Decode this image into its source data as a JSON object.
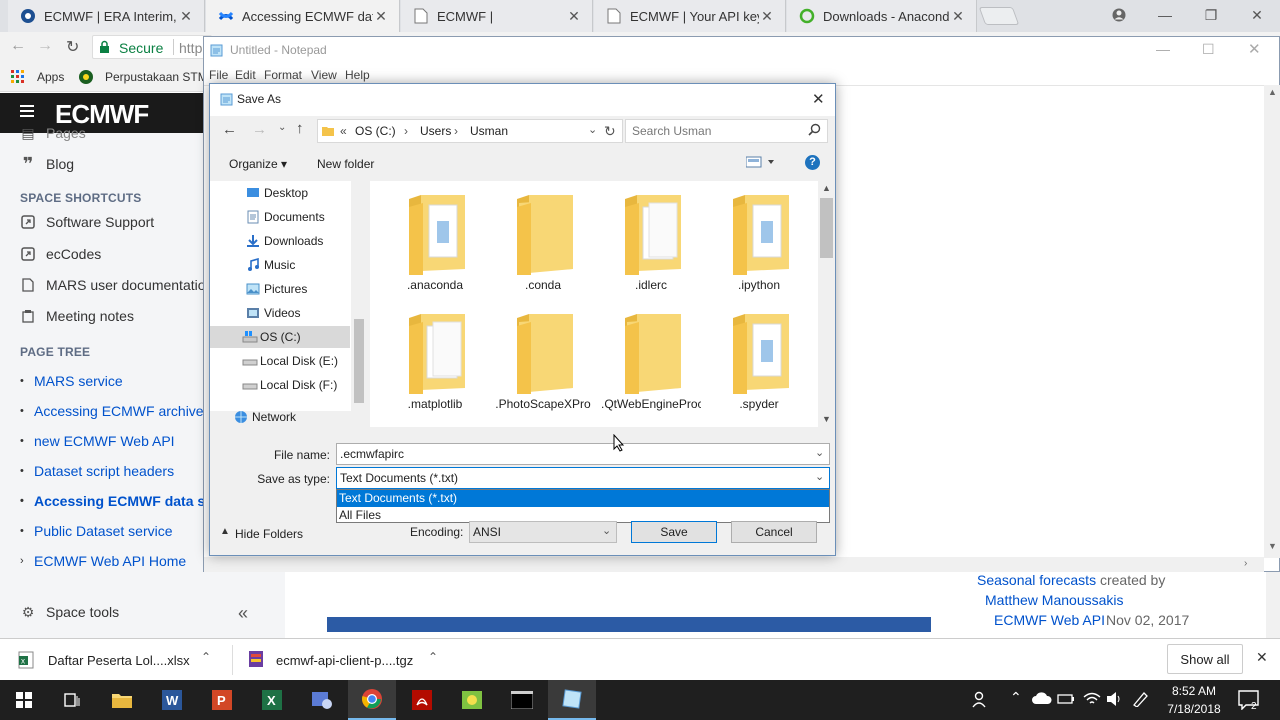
{
  "browser": {
    "tabs": [
      {
        "title": "ECMWF | ERA Interim, Da"
      },
      {
        "title": "Accessing ECMWF data s"
      },
      {
        "title": "ECMWF |"
      },
      {
        "title": "ECMWF | Your API key"
      },
      {
        "title": "Downloads - Anaconda"
      }
    ],
    "secure_label": "Secure",
    "url_partial": "http",
    "bookmarks": {
      "apps": "Apps",
      "item1": "Perpustakaan STM"
    }
  },
  "confluence": {
    "logo_text": "ECMWF",
    "pages_partial": "Pages",
    "blog": "Blog",
    "space_shortcuts_heading": "SPACE SHORTCUTS",
    "shortcuts": [
      "Software Support",
      "ecCodes",
      "MARS user documentatio",
      "Meeting notes"
    ],
    "page_tree_heading": "PAGE TREE",
    "tree": [
      {
        "label": "MARS service",
        "marker": "•",
        "bold": false
      },
      {
        "label": "Accessing ECMWF archive u",
        "marker": "•",
        "bold": false
      },
      {
        "label": "new ECMWF Web API",
        "marker": "•",
        "bold": false
      },
      {
        "label": "Dataset script headers",
        "marker": "•",
        "bold": false
      },
      {
        "label": "Accessing ECMWF data se",
        "marker": "•",
        "bold": true
      },
      {
        "label": "Public Dataset service",
        "marker": "•",
        "bold": false
      },
      {
        "label": "ECMWF Web API Home",
        "marker": "›",
        "bold": false
      }
    ],
    "space_tools": "Space tools",
    "collapse": "«",
    "recent": {
      "link1": "Seasonal forecasts",
      "created_by": "created by",
      "author": "Matthew Manoussakis",
      "space": "ECMWF Web API",
      "date": "Nov 02, 2017"
    }
  },
  "notepad": {
    "title": "Untitled - Notepad",
    "menu": [
      "File",
      "Edit",
      "Format",
      "View",
      "Help"
    ]
  },
  "dialog": {
    "title": "Save As",
    "path": [
      "«",
      "OS (C:)",
      "›",
      "Users",
      "›",
      "Usman"
    ],
    "search_placeholder": "Search Usman",
    "organize": "Organize ▾",
    "new_folder": "New folder",
    "nav": [
      {
        "label": "Desktop",
        "sel": false
      },
      {
        "label": "Documents",
        "sel": false
      },
      {
        "label": "Downloads",
        "sel": false
      },
      {
        "label": "Music",
        "sel": false
      },
      {
        "label": "Pictures",
        "sel": false
      },
      {
        "label": "Videos",
        "sel": false
      },
      {
        "label": "OS (C:)",
        "sel": true
      },
      {
        "label": "Local Disk (E:)",
        "sel": false
      },
      {
        "label": "Local Disk (F:)",
        "sel": false
      },
      {
        "label": "Network",
        "sel": false
      }
    ],
    "folders": [
      ".anaconda",
      ".conda",
      ".idlerc",
      ".ipython",
      ".matplotlib",
      ".PhotoScapeXPro",
      ".QtWebEngineProcess",
      ".spyder"
    ],
    "file_name_label": "File name:",
    "file_name_value": ".ecmwfapirc",
    "save_type_label": "Save as type:",
    "save_type_value": "Text Documents (*.txt)",
    "type_options": [
      "Text Documents (*.txt)",
      "All Files"
    ],
    "hide_folders": "Hide Folders",
    "encoding_label": "Encoding:",
    "encoding_value": "ANSI",
    "save": "Save",
    "cancel": "Cancel"
  },
  "downloads": {
    "item1": "Daftar Peserta Lol....xlsx",
    "item2": "ecmwf-api-client-p....tgz",
    "show_all": "Show all"
  },
  "taskbar": {
    "time": "8:52 AM",
    "date": "7/18/2018",
    "notif_count": "2"
  },
  "colors": {
    "accent_blue": "#0078d7",
    "link_blue": "#0052cc",
    "folder_yellow": "#f8d775",
    "confluence_dark": "#1a1a1a",
    "help_blue": "#1e73be"
  }
}
